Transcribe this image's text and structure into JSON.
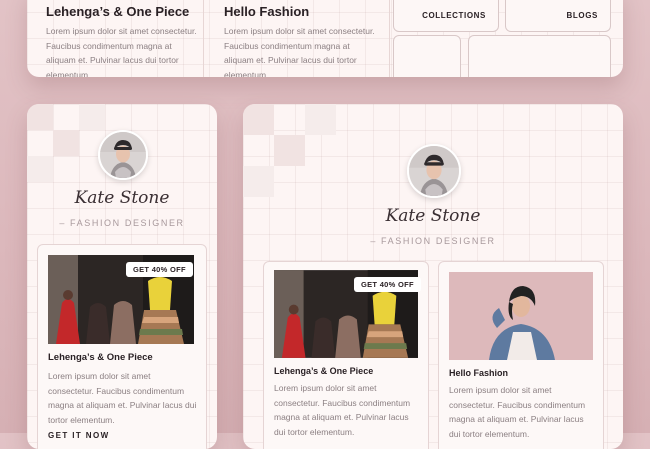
{
  "top_card": {
    "product1": {
      "title": "Lehenga’s & One Piece",
      "text": "Lorem ipsum dolor sit amet consectetur. Faucibus condimentum magna at aliquam et. Pulvinar lacus dui tortor elementum."
    },
    "product2": {
      "title": "Hello Fashion",
      "text": "Lorem ipsum dolor sit amet consectetur. Faucibus condimentum magna at aliquam et. Pulvinar lacus dui tortor elementum."
    },
    "nav": {
      "collections": "COLLECTIONS",
      "blogs": "BLOGS"
    }
  },
  "left_card": {
    "profile_name": "Kate Stone",
    "profile_role": "– FASHION DESIGNER",
    "product": {
      "badge": "GET 40% OFF",
      "title": "Lehenga’s & One Piece",
      "text": "Lorem ipsum dolor sit amet consectetur. Faucibus condimentum magna at aliquam et. Pulvinar lacus dui tortor elementum.",
      "cta": "GET IT NOW"
    }
  },
  "right_card": {
    "profile_name": "Kate Stone",
    "profile_role": "– FASHION DESIGNER",
    "product1": {
      "badge": "GET 40% OFF",
      "title": "Lehenga’s & One Piece",
      "text": "Lorem ipsum dolor sit amet consectetur. Faucibus condimentum magna at aliquam et. Pulvinar lacus dui tortor elementum."
    },
    "product2": {
      "title": "Hello Fashion",
      "text": "Lorem ipsum dolor sit amet consectetur. Faucibus condimentum magna at aliquam et. Pulvinar lacus dui tortor elementum."
    }
  },
  "colors": {
    "background": "#dcb8bc",
    "card": "#fdf5f4",
    "text": "#2a2125",
    "muted": "#8b7f82"
  }
}
